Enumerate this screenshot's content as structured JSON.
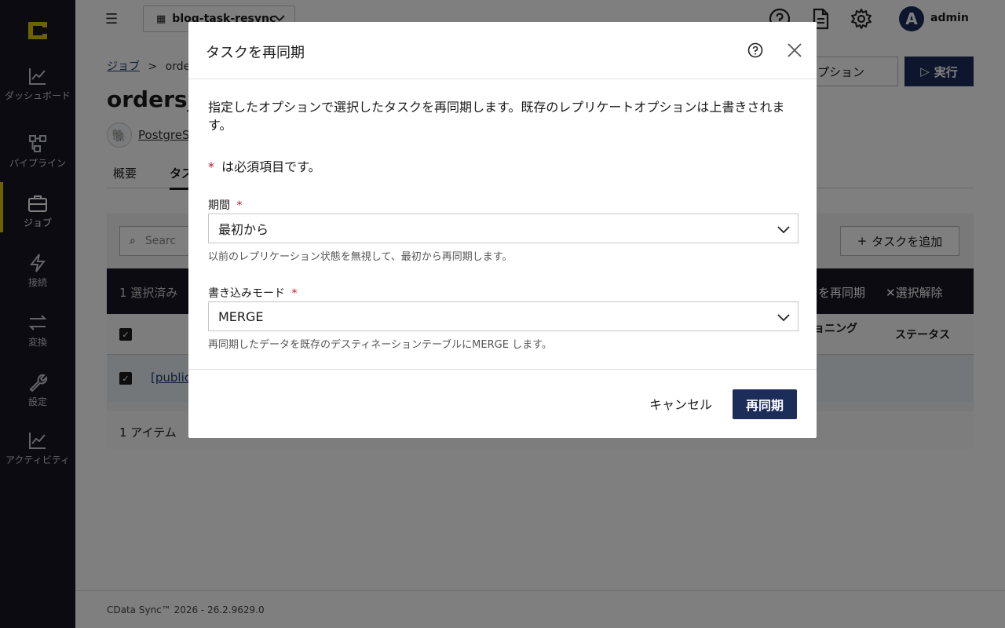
{
  "sidebar": {
    "items": [
      {
        "label": "ダッシュボード"
      },
      {
        "label": "パイプライン"
      },
      {
        "label": "ジョブ"
      },
      {
        "label": "接続"
      },
      {
        "label": "変換"
      },
      {
        "label": "設定"
      },
      {
        "label": "アクティビティ"
      }
    ]
  },
  "topbar": {
    "menu_glyph": "☰",
    "project": "blog-task-resync",
    "user": "admin",
    "avatar_letter": "A"
  },
  "page": {
    "breadcrumb_root": "ジョブ",
    "breadcrumb_sep": ">",
    "breadcrumb_current": "orders",
    "title": "orders_",
    "source": "PostgreS",
    "tabs": [
      "概要",
      "タス"
    ],
    "options_label": "プション",
    "run_label": "実行",
    "search_placeholder": "Searc",
    "add_task_label": "タスクを追加",
    "selection_count": "1 選択済み",
    "resync_action": "を再同期",
    "clear_action": "選択解除",
    "col_partitioning": "ョニング",
    "col_status": "ステータス",
    "row_link": "[public",
    "items_count": "1 アイテム"
  },
  "footer": {
    "version": "CData Sync™ 2026 - 26.2.9629.0"
  },
  "modal": {
    "title": "タスクを再同期",
    "description": "指定したオプションで選択したタスクを再同期します。既存のレプリケートオプションは上書きされます。",
    "required_mark": "*",
    "required_note": "は必須項目です。",
    "period_label": "期間",
    "period_value": "最初から",
    "period_help": "以前のレプリケーション状態を無視して、最初から再同期します。",
    "write_mode_label": "書き込みモード",
    "write_mode_value": "MERGE",
    "write_mode_help": "再同期したデータを既存のデスティネーションテーブルにMERGE します。",
    "cancel_label": "キャンセル",
    "resync_label": "再同期"
  },
  "colors": {
    "sidebar_bg": "#161722",
    "accent": "#d8c600",
    "primary": "#1d2d5a",
    "required": "#c0142c"
  }
}
